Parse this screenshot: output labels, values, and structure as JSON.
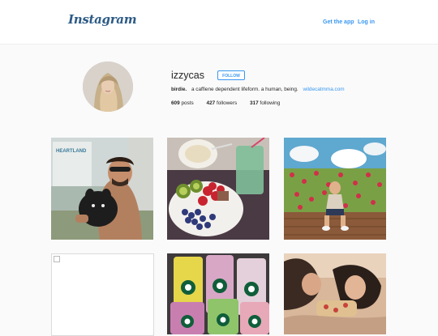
{
  "nav": {
    "logo": "Instagram",
    "get_app": "Get the app",
    "login": "Log in"
  },
  "profile": {
    "username": "izzycas",
    "follow_label": "FOLLOW",
    "bio_name": "birdie.",
    "bio_text": "a caffiene dependent lifeform. a human, being.",
    "bio_link": "wildecatmma.com",
    "posts_count": "609",
    "posts_label": "posts",
    "followers_count": "427",
    "followers_label": "followers",
    "following_count": "317",
    "following_label": "following"
  },
  "posts": [
    {
      "caption_visible": "HEARTLAND"
    },
    {},
    {},
    {},
    {},
    {}
  ]
}
